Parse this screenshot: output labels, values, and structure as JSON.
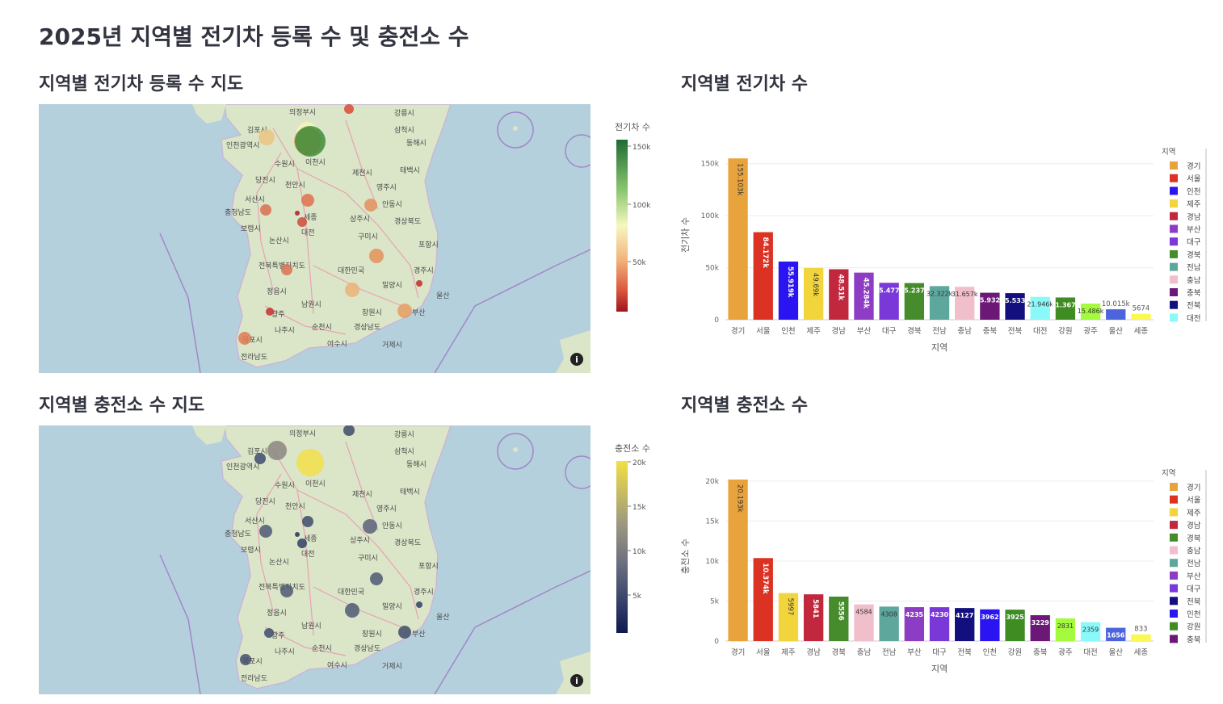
{
  "page_title": "2025년 지역별 전기차 등록 수 및 충전소 수",
  "sections": {
    "ev_map_title": "지역별 전기차 등록 수 지도",
    "ev_bar_title": "지역별 전기차 수",
    "charger_map_title": "지역별 충전소 수 지도",
    "charger_bar_title": "지역별 충전소 수"
  },
  "map_labels": [
    {
      "name": "의정부시"
    },
    {
      "name": "강릉시"
    },
    {
      "name": "김포시"
    },
    {
      "name": "삼척시"
    },
    {
      "name": "인천광역시"
    },
    {
      "name": "동해시"
    },
    {
      "name": "수원시"
    },
    {
      "name": "이천시"
    },
    {
      "name": "태백시"
    },
    {
      "name": "당진시"
    },
    {
      "name": "천안시"
    },
    {
      "name": "제천시"
    },
    {
      "name": "영주시"
    },
    {
      "name": "서산시"
    },
    {
      "name": "충청남도"
    },
    {
      "name": "안동시"
    },
    {
      "name": "보령시"
    },
    {
      "name": "세종"
    },
    {
      "name": "상주시"
    },
    {
      "name": "경상북도"
    },
    {
      "name": "대전"
    },
    {
      "name": "논산시"
    },
    {
      "name": "구미시"
    },
    {
      "name": "포항시"
    },
    {
      "name": "전북특별자치도"
    },
    {
      "name": "대한민국"
    },
    {
      "name": "경주시"
    },
    {
      "name": "정읍시"
    },
    {
      "name": "밀양시"
    },
    {
      "name": "울산"
    },
    {
      "name": "남원시"
    },
    {
      "name": "광주"
    },
    {
      "name": "창원시"
    },
    {
      "name": "부산"
    },
    {
      "name": "나주시"
    },
    {
      "name": "순천시"
    },
    {
      "name": "경상남도"
    },
    {
      "name": "목포시"
    },
    {
      "name": "여수시"
    },
    {
      "name": "거제시"
    },
    {
      "name": "전라남도"
    }
  ],
  "ev_colorbar": {
    "title": "전기차 수",
    "ticks": [
      "150k",
      "100k",
      "50k"
    ]
  },
  "charger_colorbar": {
    "title": "충전소 수",
    "ticks": [
      "20k",
      "15k",
      "10k",
      "5k"
    ]
  },
  "chart_data": [
    {
      "type": "bar",
      "title": "지역별 전기차 수",
      "xlabel": "지역",
      "ylabel": "전기차 수",
      "ylim": [
        0,
        163000
      ],
      "yticks": [
        0,
        50000,
        100000,
        150000
      ],
      "ytick_labels": [
        "0",
        "50k",
        "100k",
        "150k"
      ],
      "legend_title": "지역",
      "legend_position": "right",
      "categories": [
        "경기",
        "서울",
        "인천",
        "제주",
        "경남",
        "부산",
        "대구",
        "경북",
        "전남",
        "충남",
        "충북",
        "전북",
        "대전",
        "강원",
        "광주",
        "울산",
        "세종"
      ],
      "values": [
        155103,
        84172,
        55919,
        49690,
        48510,
        45284,
        35477,
        35237,
        32322,
        31657,
        25932,
        25533,
        21946,
        21367,
        15486,
        10015,
        5674
      ],
      "value_labels": [
        "155.103k",
        "84.172k",
        "55.919k",
        "49.69k",
        "48.51k",
        "45.284k",
        "35.477k",
        "35.237k",
        "32.322k",
        "31.657k",
        "25.932k",
        "25.533k",
        "21.946k",
        "21.367k",
        "15.486k",
        "10.015k",
        "5674"
      ],
      "colors": [
        "#e8a33d",
        "#dc3223",
        "#2a15f2",
        "#f2d43c",
        "#c1283e",
        "#8d3cc4",
        "#7b38d8",
        "#468c2c",
        "#5da79d",
        "#f0bfcb",
        "#6b1877",
        "#140f7e",
        "#8bf8fa",
        "#3f8c23",
        "#a4fa3c",
        "#4c65dd",
        "#fbf851"
      ],
      "legend_items": [
        "경기",
        "서울",
        "인천",
        "제주",
        "경남",
        "부산",
        "대구",
        "경북",
        "전남",
        "충남",
        "충북",
        "전북",
        "대전"
      ]
    },
    {
      "type": "bar",
      "title": "지역별 충전소 수",
      "xlabel": "지역",
      "ylabel": "충전소 수",
      "ylim": [
        0,
        21200
      ],
      "yticks": [
        0,
        5000,
        10000,
        15000,
        20000
      ],
      "ytick_labels": [
        "0",
        "5k",
        "10k",
        "15k",
        "20k"
      ],
      "legend_title": "지역",
      "legend_position": "right",
      "categories": [
        "경기",
        "서울",
        "제주",
        "경남",
        "경북",
        "충남",
        "전남",
        "부산",
        "대구",
        "전북",
        "인천",
        "강원",
        "충북",
        "광주",
        "대전",
        "울산",
        "세종"
      ],
      "values": [
        20193,
        10374,
        5997,
        5841,
        5556,
        4584,
        4308,
        4235,
        4230,
        4127,
        3962,
        3925,
        3229,
        2831,
        2359,
        1656,
        833
      ],
      "value_labels": [
        "20.193k",
        "10.374k",
        "5997",
        "5841",
        "5556",
        "4584",
        "4308",
        "4235",
        "4230",
        "4127",
        "3962",
        "3925",
        "3229",
        "2831",
        "2359",
        "1656",
        "833"
      ],
      "colors": [
        "#e8a33d",
        "#dc3223",
        "#f2d43c",
        "#c1283e",
        "#468c2c",
        "#f0bfcb",
        "#5da79d",
        "#8d3cc4",
        "#7b38d8",
        "#140f7e",
        "#2a15f2",
        "#3f8c23",
        "#6b1877",
        "#a4fa3c",
        "#8bf8fa",
        "#4c65dd",
        "#fbf851"
      ],
      "legend_items": [
        "경기",
        "서울",
        "제주",
        "경남",
        "경북",
        "충남",
        "전남",
        "부산",
        "대구",
        "전북",
        "인천",
        "강원",
        "충북"
      ]
    }
  ]
}
